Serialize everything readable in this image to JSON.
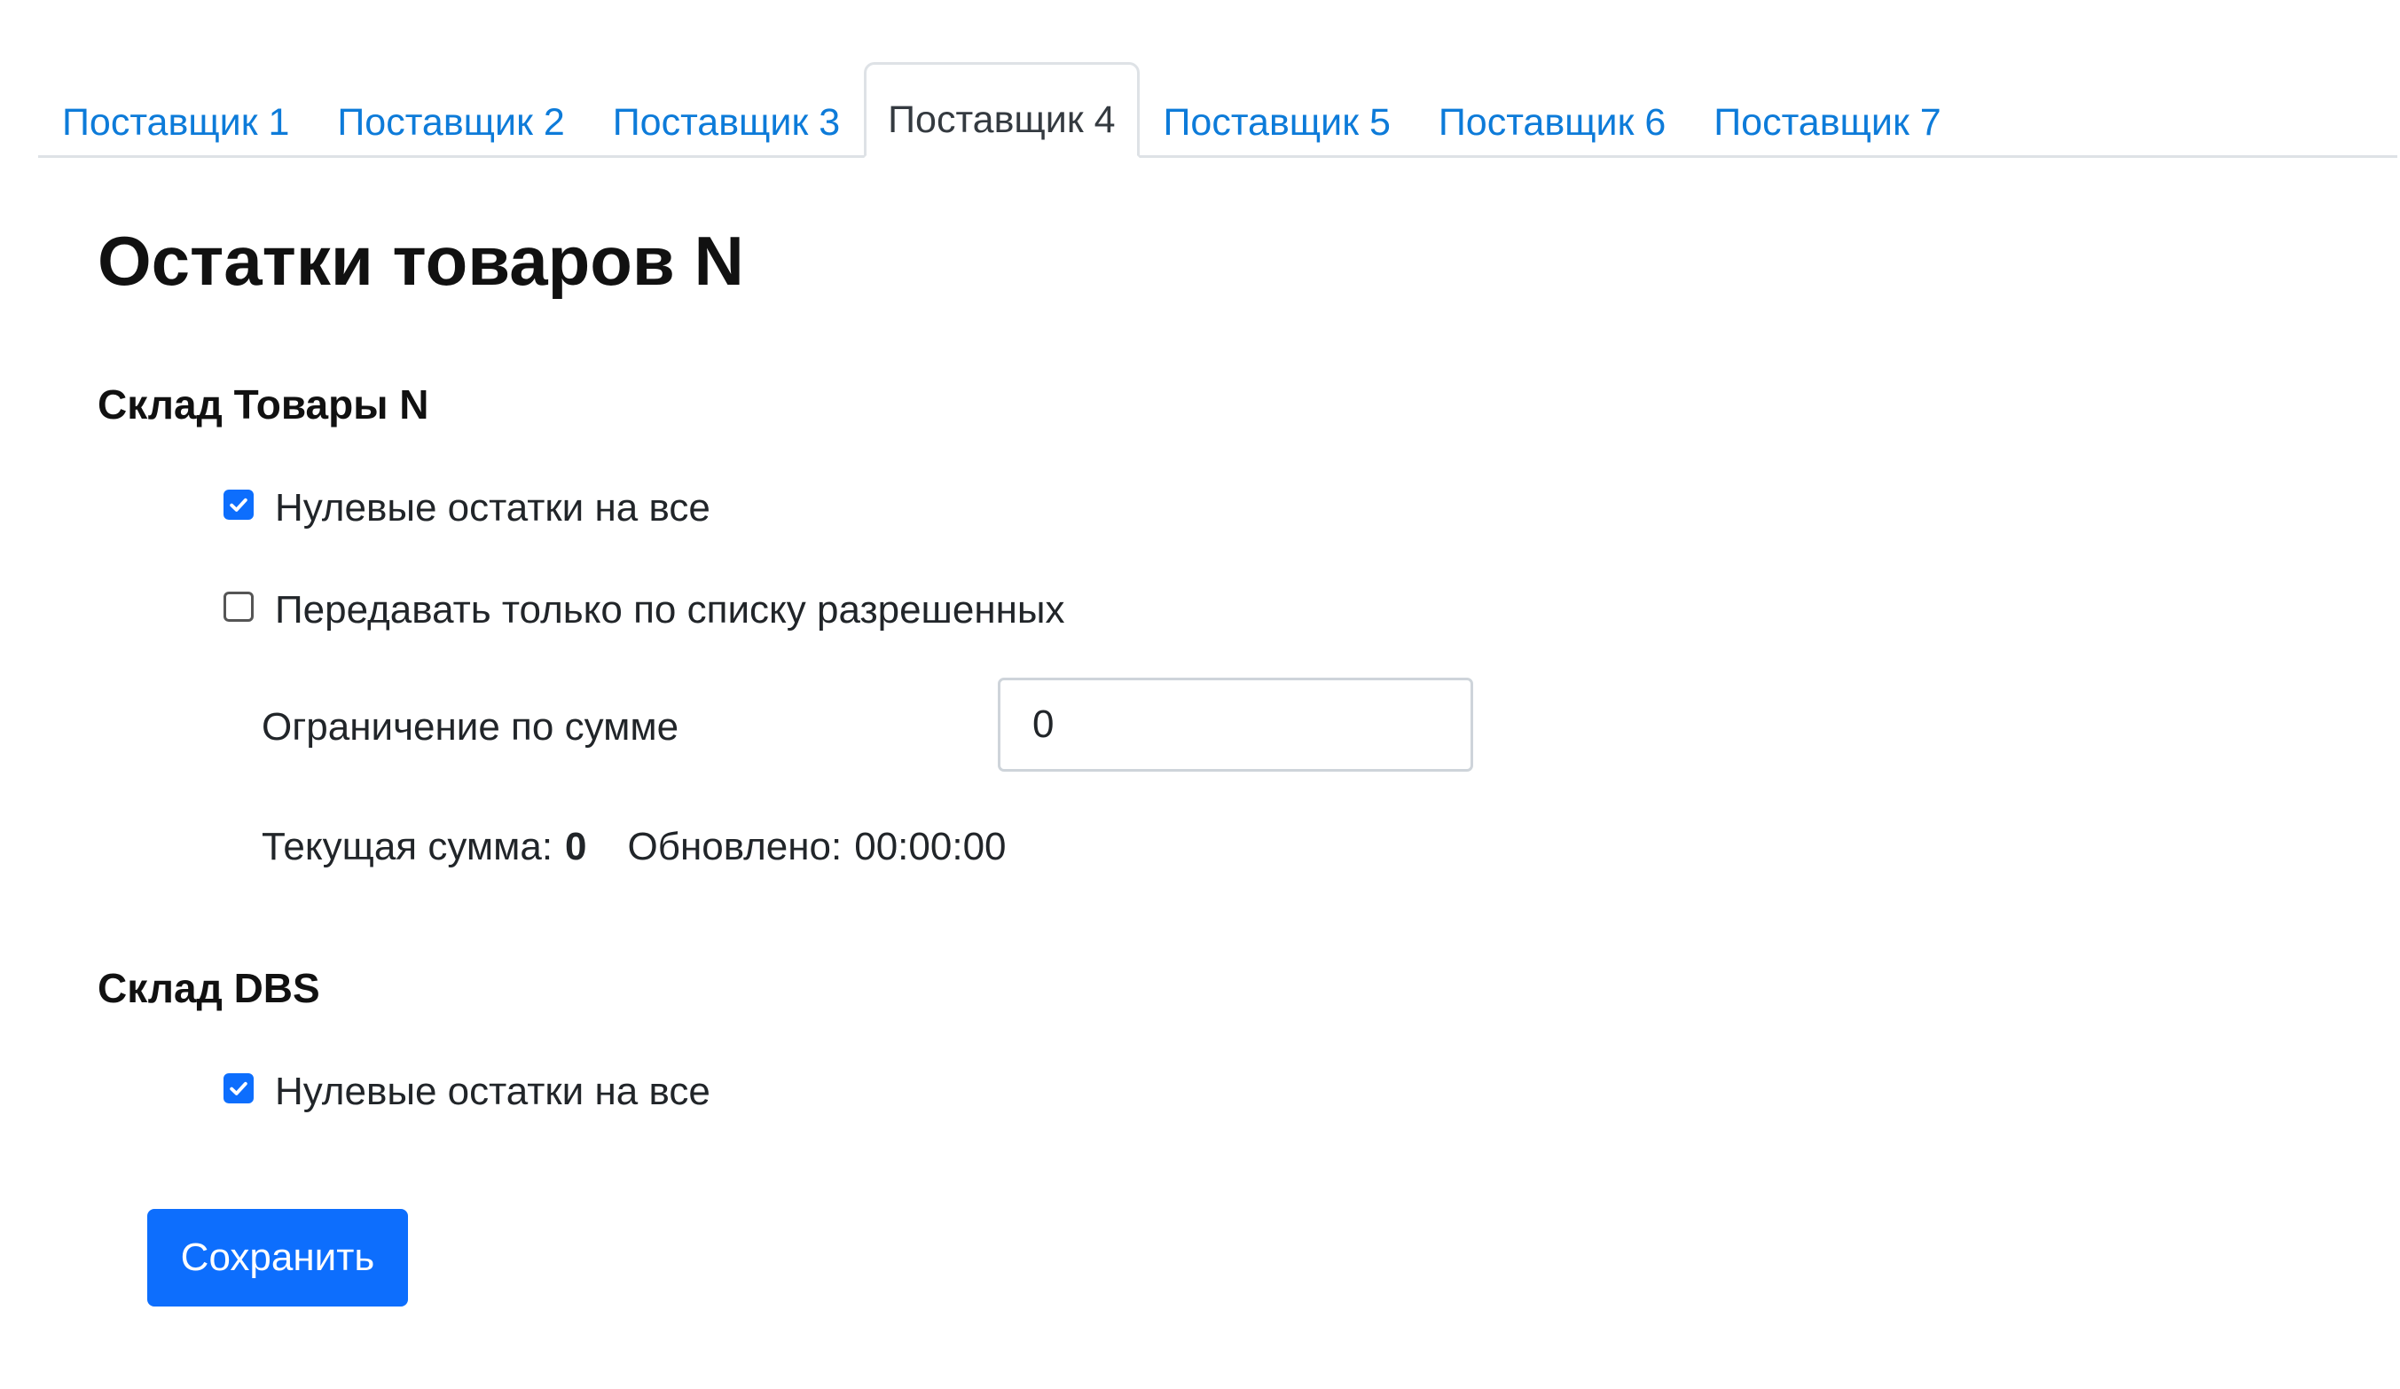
{
  "tabs": [
    {
      "label": "Поставщик 1",
      "active": false
    },
    {
      "label": "Поставщик 2",
      "active": false
    },
    {
      "label": "Поставщик 3",
      "active": false
    },
    {
      "label": "Поставщик 4",
      "active": true
    },
    {
      "label": "Поставщик 5",
      "active": false
    },
    {
      "label": "Поставщик 6",
      "active": false
    },
    {
      "label": "Поставщик 7",
      "active": false
    }
  ],
  "page": {
    "title": "Остатки товаров N"
  },
  "warehouse_n": {
    "title": "Склад Товары N",
    "zero_stock": {
      "label": "Нулевые остатки на все",
      "checked": true
    },
    "allowed_list_only": {
      "label": "Передавать только по списку разрешенных",
      "checked": false
    },
    "sum_limit": {
      "label": "Ограничение по сумме",
      "value": "0"
    },
    "current_sum_label": "Текущая сумма:",
    "current_sum_value": "0",
    "updated_label": "Обновлено:",
    "updated_time": "00:00:00"
  },
  "warehouse_dbs": {
    "title": "Склад DBS",
    "zero_stock": {
      "label": "Нулевые остатки на все",
      "checked": true
    }
  },
  "actions": {
    "save_label": "Сохранить"
  },
  "colors": {
    "link": "#0d7bd9",
    "primary": "#0d6efd",
    "border": "#dee2e6"
  }
}
